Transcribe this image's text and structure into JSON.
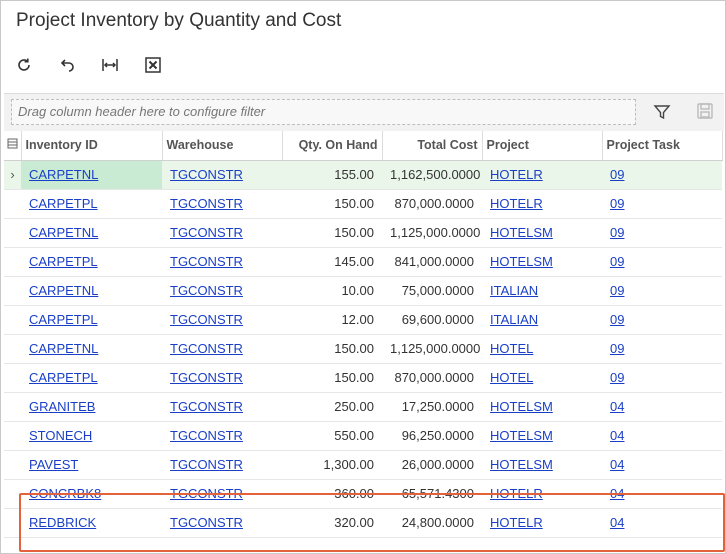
{
  "title": "Project Inventory by Quantity and Cost",
  "toolbar": {
    "icons": [
      "refresh-icon",
      "undo-icon",
      "fit-to-screen-icon",
      "export-excel-icon"
    ]
  },
  "filter": {
    "placeholder": "Drag column header here to configure filter"
  },
  "columns": [
    "Inventory ID",
    "Warehouse",
    "Qty. On Hand",
    "Total Cost",
    "Project",
    "Project Task"
  ],
  "rows": [
    {
      "inventory_id": "CARPETNL",
      "warehouse": "TGCONSTR",
      "qty": "155.00",
      "cost": "1,162,500.0000",
      "project": "HOTELR",
      "task": "09"
    },
    {
      "inventory_id": "CARPETPL",
      "warehouse": "TGCONSTR",
      "qty": "150.00",
      "cost": "870,000.0000",
      "project": "HOTELR",
      "task": "09"
    },
    {
      "inventory_id": "CARPETNL",
      "warehouse": "TGCONSTR",
      "qty": "150.00",
      "cost": "1,125,000.0000",
      "project": "HOTELSM",
      "task": "09"
    },
    {
      "inventory_id": "CARPETPL",
      "warehouse": "TGCONSTR",
      "qty": "145.00",
      "cost": "841,000.0000",
      "project": "HOTELSM",
      "task": "09"
    },
    {
      "inventory_id": "CARPETNL",
      "warehouse": "TGCONSTR",
      "qty": "10.00",
      "cost": "75,000.0000",
      "project": "ITALIAN",
      "task": "09"
    },
    {
      "inventory_id": "CARPETPL",
      "warehouse": "TGCONSTR",
      "qty": "12.00",
      "cost": "69,600.0000",
      "project": "ITALIAN",
      "task": "09"
    },
    {
      "inventory_id": "CARPETNL",
      "warehouse": "TGCONSTR",
      "qty": "150.00",
      "cost": "1,125,000.0000",
      "project": "HOTEL",
      "task": "09"
    },
    {
      "inventory_id": "CARPETPL",
      "warehouse": "TGCONSTR",
      "qty": "150.00",
      "cost": "870,000.0000",
      "project": "HOTEL",
      "task": "09"
    },
    {
      "inventory_id": "GRANITEB",
      "warehouse": "TGCONSTR",
      "qty": "250.00",
      "cost": "17,250.0000",
      "project": "HOTELSM",
      "task": "04"
    },
    {
      "inventory_id": "STONECH",
      "warehouse": "TGCONSTR",
      "qty": "550.00",
      "cost": "96,250.0000",
      "project": "HOTELSM",
      "task": "04"
    },
    {
      "inventory_id": "PAVEST",
      "warehouse": "TGCONSTR",
      "qty": "1,300.00",
      "cost": "26,000.0000",
      "project": "HOTELSM",
      "task": "04"
    },
    {
      "inventory_id": "CONCRBK8",
      "warehouse": "TGCONSTR",
      "qty": "360.00",
      "cost": "65,571.4300",
      "project": "HOTELR",
      "task": "04"
    },
    {
      "inventory_id": "REDBRICK",
      "warehouse": "TGCONSTR",
      "qty": "320.00",
      "cost": "24,800.0000",
      "project": "HOTELR",
      "task": "04"
    }
  ],
  "colors": {
    "link": "#1a3fc7",
    "active_row": "#eaf6ea",
    "highlight_border": "#e4623b"
  }
}
